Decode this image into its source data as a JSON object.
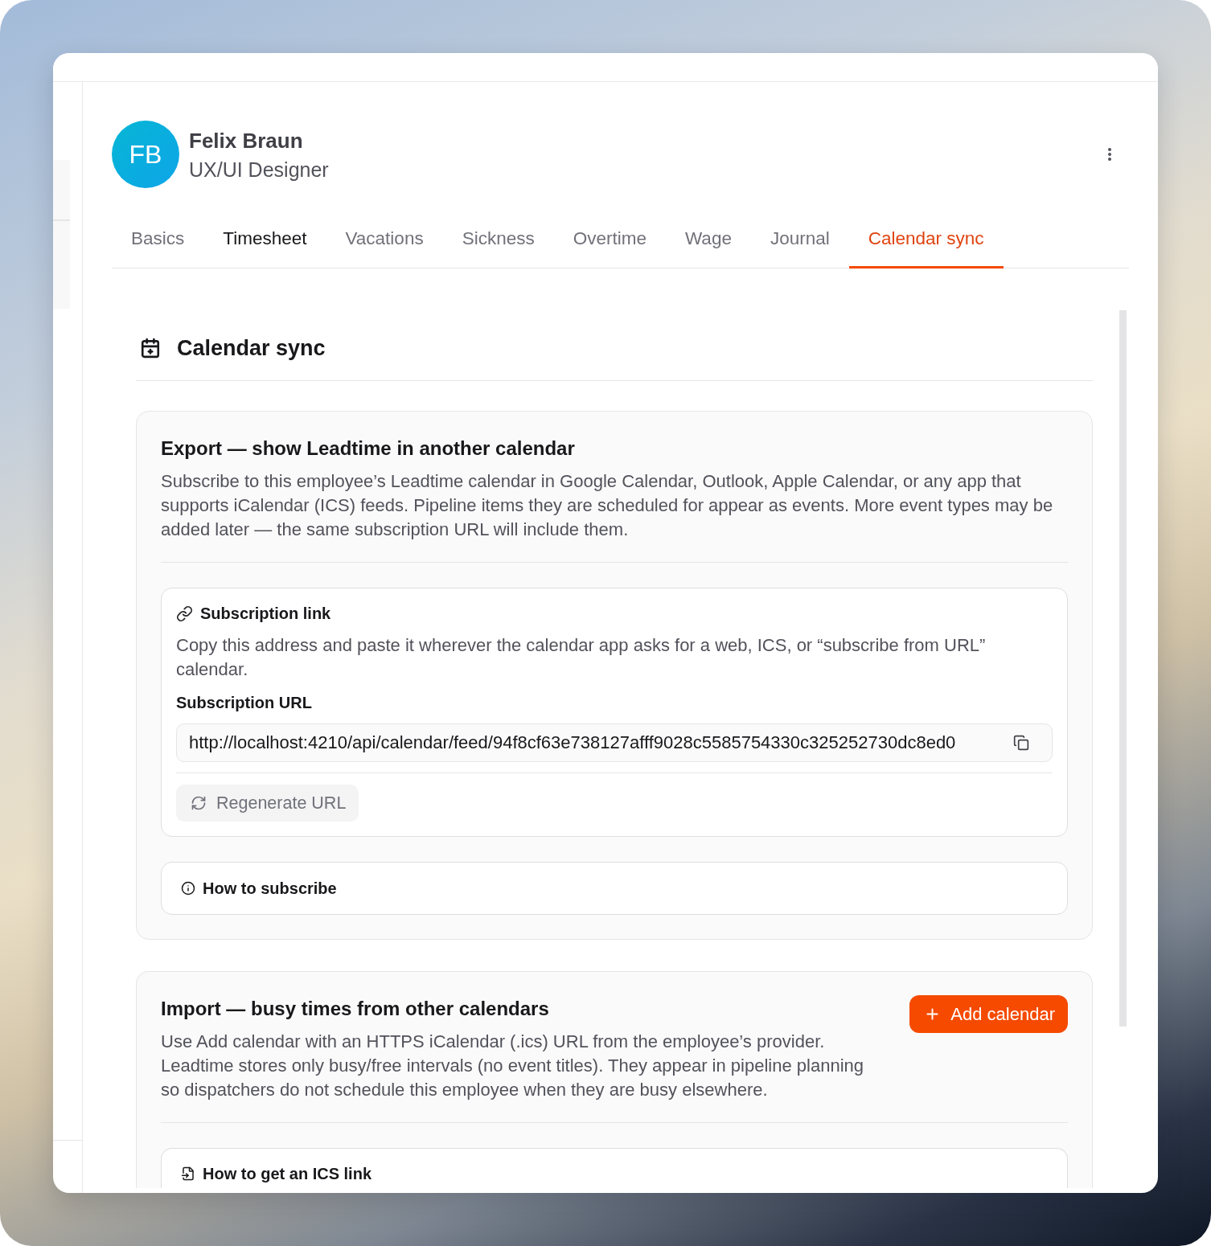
{
  "profile": {
    "initials": "FB",
    "name": "Felix Braun",
    "role": "UX/UI Designer"
  },
  "tabs": [
    {
      "label": "Basics",
      "selected": false,
      "hovered": false
    },
    {
      "label": "Timesheet",
      "selected": false,
      "hovered": true
    },
    {
      "label": "Vacations",
      "selected": false,
      "hovered": false
    },
    {
      "label": "Sickness",
      "selected": false,
      "hovered": false
    },
    {
      "label": "Overtime",
      "selected": false,
      "hovered": false
    },
    {
      "label": "Wage",
      "selected": false,
      "hovered": false
    },
    {
      "label": "Journal",
      "selected": false,
      "hovered": false
    },
    {
      "label": "Calendar sync",
      "selected": true,
      "hovered": false
    }
  ],
  "section": {
    "title": "Calendar sync"
  },
  "export": {
    "title": "Export — show Leadtime in another calendar",
    "description": "Subscribe to this employee’s Leadtime calendar in Google Calendar, Outlook, Apple Calendar, or any app that supports iCalendar (ICS) feeds. Pipeline items they are scheduled for appear as events. More event types may be added later — the same subscription URL will include them.",
    "subscription": {
      "title": "Subscription link",
      "description": "Copy this address and paste it wherever the calendar app asks for a web, ICS, or “subscribe from URL” calendar.",
      "url_label": "Subscription URL",
      "url_value": "http://localhost:4210/api/calendar/feed/94f8cf63e738127afff9028c5585754330c325252730dc8ed0",
      "regenerate_button": "Regenerate URL"
    },
    "help": {
      "title": "How to subscribe"
    }
  },
  "import": {
    "title": "Import — busy times from other calendars",
    "description": "Use Add calendar with an HTTPS iCalendar (.ics) URL from the employee’s provider. Leadtime stores only busy/free intervals (no event titles). They appear in pipeline planning so dispatchers do not schedule this employee when they are busy elsewhere.",
    "add_button": "Add calendar",
    "help": {
      "title": "How to get an ICS link"
    }
  }
}
